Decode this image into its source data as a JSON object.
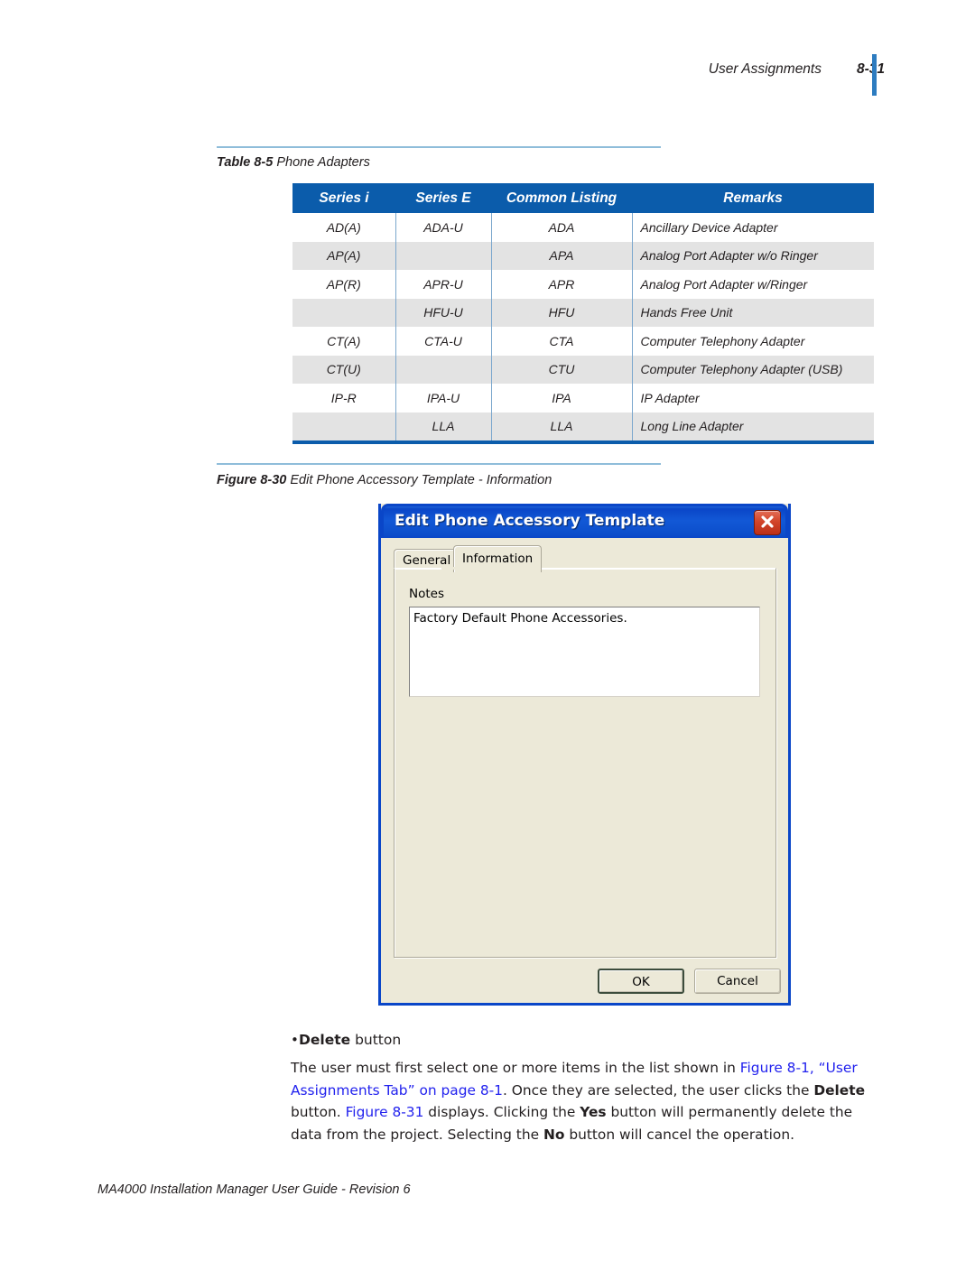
{
  "page": {
    "header_title": "User Assignments",
    "page_number": "8-31",
    "footer": "MA4000 Installation Manager User Guide - Revision 6"
  },
  "table_caption": {
    "lead": "Table 8-5",
    "text": "Phone Adapters"
  },
  "figure_caption": {
    "lead": "Figure 8-30",
    "text": "Edit Phone Accessory Template - Information"
  },
  "adapters_table": {
    "columns": [
      "Series i",
      "Series E",
      "Common Listing",
      "Remarks"
    ],
    "rows": [
      [
        "AD(A)",
        "ADA-U",
        "ADA",
        "Ancillary Device Adapter"
      ],
      [
        "AP(A)",
        "",
        "APA",
        "Analog Port Adapter w/o Ringer"
      ],
      [
        "AP(R)",
        "APR-U",
        "APR",
        "Analog Port Adapter w/Ringer"
      ],
      [
        "",
        "HFU-U",
        "HFU",
        "Hands Free Unit"
      ],
      [
        "CT(A)",
        "CTA-U",
        "CTA",
        "Computer Telephony Adapter"
      ],
      [
        "CT(U)",
        "",
        "CTU",
        "Computer Telephony Adapter (USB)"
      ],
      [
        "IP-R",
        "IPA-U",
        "IPA",
        "IP Adapter"
      ],
      [
        "",
        "LLA",
        "LLA",
        "Long Line Adapter"
      ]
    ]
  },
  "dialog": {
    "title": "Edit Phone Accessory Template",
    "close_icon": "close-icon",
    "tabs": [
      {
        "label": "General",
        "active": false
      },
      {
        "label": "Information",
        "active": true
      }
    ],
    "notes_label": "Notes",
    "notes_value": "Factory Default Phone Accessories.",
    "buttons": {
      "ok": "OK",
      "cancel": "Cancel"
    }
  },
  "body": {
    "bullet_bold": "Delete",
    "bullet_rest": " button",
    "paragraph": {
      "p1": "The user must first select one or more items in the list shown in ",
      "link1": "Figure 8-1, “User Assignments Tab” on page 8-1",
      "p2": ". Once they are selected, the user clicks the ",
      "b1": "Delete",
      "p3": " button. ",
      "link2": "Figure 8-31",
      "p4": " displays. Clicking the ",
      "b2": "Yes",
      "p5": " button will permanently delete the data from the project. Selecting the ",
      "b3": "No",
      "p6": " button will cancel the operation."
    }
  },
  "colors": {
    "table_header_blue": "#0b5cab",
    "caption_rule_blue": "#8fbdda",
    "header_bar_blue": "#2d7cc0",
    "xref_blue": "#2222ee",
    "dialog_titlebar_blue": "#0a46c8",
    "dialog_face": "#ece9d8",
    "close_button_red": "#d2452a",
    "alt_row_gray": "#e3e3e3"
  }
}
